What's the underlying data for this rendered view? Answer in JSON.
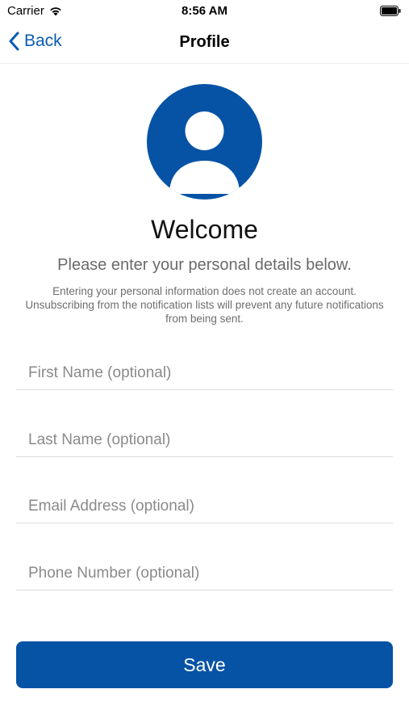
{
  "status_bar": {
    "carrier": "Carrier",
    "time": "8:56 AM"
  },
  "nav": {
    "back_label": "Back",
    "title": "Profile"
  },
  "header": {
    "welcome": "Welcome",
    "subtitle": "Please enter your personal details below.",
    "notice": "Entering your personal information does not create an account. Unsubscribing from the notification lists will prevent any future notifications from being sent."
  },
  "form": {
    "first_name": {
      "value": "",
      "placeholder": "First Name (optional)"
    },
    "last_name": {
      "value": "",
      "placeholder": "Last Name (optional)"
    },
    "email": {
      "value": "",
      "placeholder": "Email Address (optional)"
    },
    "phone": {
      "value": "",
      "placeholder": "Phone Number (optional)"
    }
  },
  "actions": {
    "save_label": "Save"
  },
  "icons": {
    "wifi": "wifi-icon",
    "battery": "battery-icon",
    "back": "chevron-left-icon",
    "avatar": "user-avatar-icon"
  },
  "colors": {
    "accent": "#0653a6",
    "link": "#0a5bb3",
    "muted_text": "#6a6a6a",
    "divider": "#dcdcdc"
  }
}
